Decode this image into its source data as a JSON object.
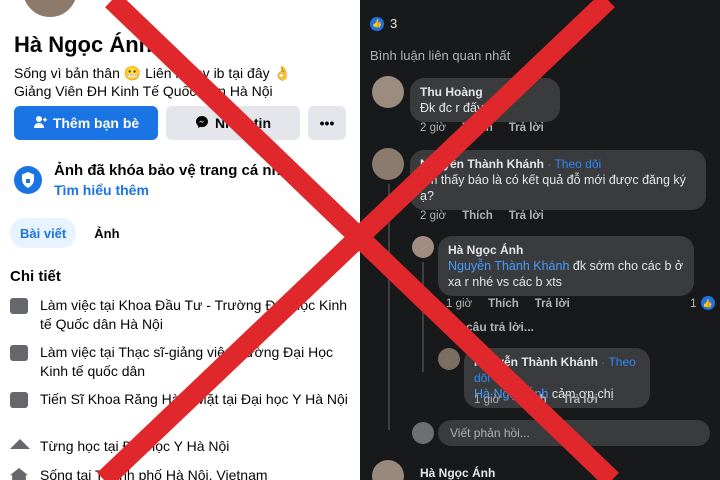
{
  "profile": {
    "name": "Hà Ngọc Ánh",
    "bio_line1": "Sống vì bản thân 😬 Liên hệ ny ib tại đây 👌",
    "bio_line2": "Giảng Viên ĐH Kinh Tế Quốc Dân Hà Nội",
    "add_friend_label": "Thêm bạn bè",
    "message_label": "Nhắn tin",
    "more_label": "•••",
    "locked_title": "Ảnh đã khóa bảo vệ trang cá nhân",
    "locked_link": "Tìm hiểu thêm",
    "tab_posts": "Bài viết",
    "tab_photos": "Ảnh",
    "details_title": "Chi tiết",
    "details": [
      "Làm việc tại Khoa Đầu Tư - Trường Đại Học Kinh tế Quốc dân Hà Nội",
      "Làm việc tại Thạc sĩ-giảng viên trường Đại Học Kinh tế quốc dân",
      "Tiến Sĩ Khoa Răng Hàm Mặt tại Đại học Y Hà Nội",
      "Từng học tại Đại học Y Hà Nội",
      "Sống tại Thành phố Hà Nội, Vietnam"
    ]
  },
  "comments": {
    "like_count": "3",
    "sort_label": "Bình luận liên quan nhất",
    "c1": {
      "author": "Thu Hoàng",
      "text": "Đk đc r đấy",
      "time": "2 giờ",
      "like": "Thích",
      "reply": "Trả lời"
    },
    "c2": {
      "author": "Nguyễn Thành Khánh",
      "follow": "· Theo dõi",
      "text": "em thấy báo là có kết quả đỗ mới được đăng ký ạ?",
      "time": "2 giờ",
      "like": "Thích",
      "reply": "Trả lời"
    },
    "c3": {
      "author": "Hà Ngọc Ánh",
      "mention": "Nguyễn Thành Khánh",
      "text": " đk sớm cho các b ở xa r nhé vs các b xts",
      "time": "1 giờ",
      "like": "Thích",
      "reply": "Trả lời",
      "reactions": "1"
    },
    "more_replies": "1 câu trả lời...",
    "c4": {
      "author": "Nguyễn Thành Khánh",
      "follow": "· Theo dõi",
      "mention": "Hà Ngọc Ánh",
      "text": " cảm ơn chị",
      "time": "1 giờ",
      "like": "Thích",
      "reply": "Trả lời"
    },
    "reply_placeholder": "Viết phản hồi...",
    "c5_author": "Hà Ngọc Ánh"
  },
  "overlay": {
    "color": "#e0272b"
  }
}
